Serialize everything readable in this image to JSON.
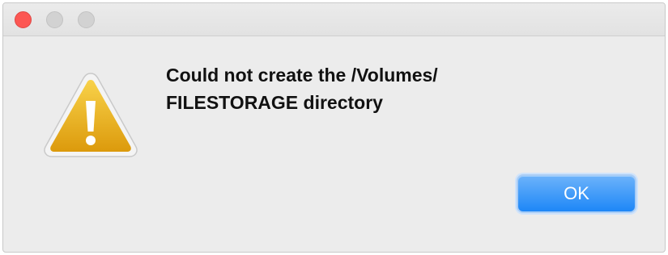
{
  "window": {
    "controls": [
      {
        "name": "close",
        "color": "#fc5753"
      },
      {
        "name": "minimize",
        "color": "#d2d2d2"
      },
      {
        "name": "zoom",
        "color": "#d2d2d2"
      }
    ]
  },
  "alert": {
    "icon": "warning-triangle-icon",
    "icon_color": "#f0b51a",
    "message_lines": [
      "Could not create the /Volumes/",
      "FILESTORAGE directory"
    ]
  },
  "buttons": {
    "ok_label": "OK",
    "ok_color": "#1d87f7"
  }
}
